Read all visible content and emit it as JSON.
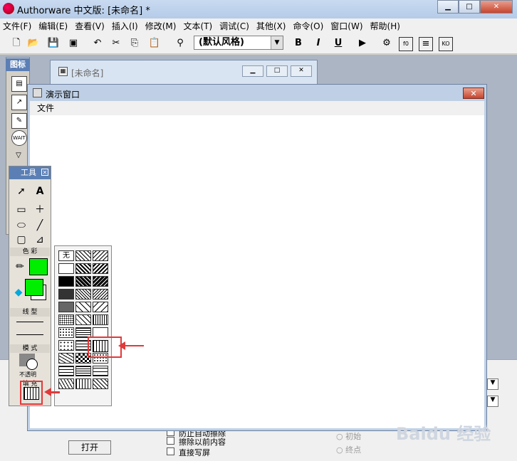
{
  "window": {
    "title": "Authorware 中文版: [未命名] *"
  },
  "menubar": [
    "文件(F)",
    "编辑(E)",
    "查看(V)",
    "插入(I)",
    "修改(M)",
    "文本(T)",
    "调试(C)",
    "其他(X)",
    "命令(O)",
    "窗口(W)",
    "帮助(H)"
  ],
  "toolbar": {
    "style_value": "(默认风格)",
    "bold": "B",
    "italic": "I",
    "underline": "U"
  },
  "icon_palette": {
    "title": "图标"
  },
  "flow_window": {
    "title": "[未命名]"
  },
  "presentation": {
    "title": "演示窗口",
    "menu": "文件"
  },
  "tools_panel": {
    "title": "工具",
    "section_color": "色 彩",
    "section_line": "线 型",
    "section_mode": "模 式",
    "mode_value": "不透明",
    "section_fill": "填 充",
    "fill_color": "#00ee00",
    "stroke_color": "#00ee00"
  },
  "pattern_palette": {
    "none_label": "无"
  },
  "bottom_panel": {
    "open_button": "打开",
    "check1": "防止自动擦除",
    "check2": "擦除以前内容",
    "check3": "直接写屏",
    "radio1": "初始",
    "radio2": "终点"
  },
  "watermark": "Baidu 经验"
}
